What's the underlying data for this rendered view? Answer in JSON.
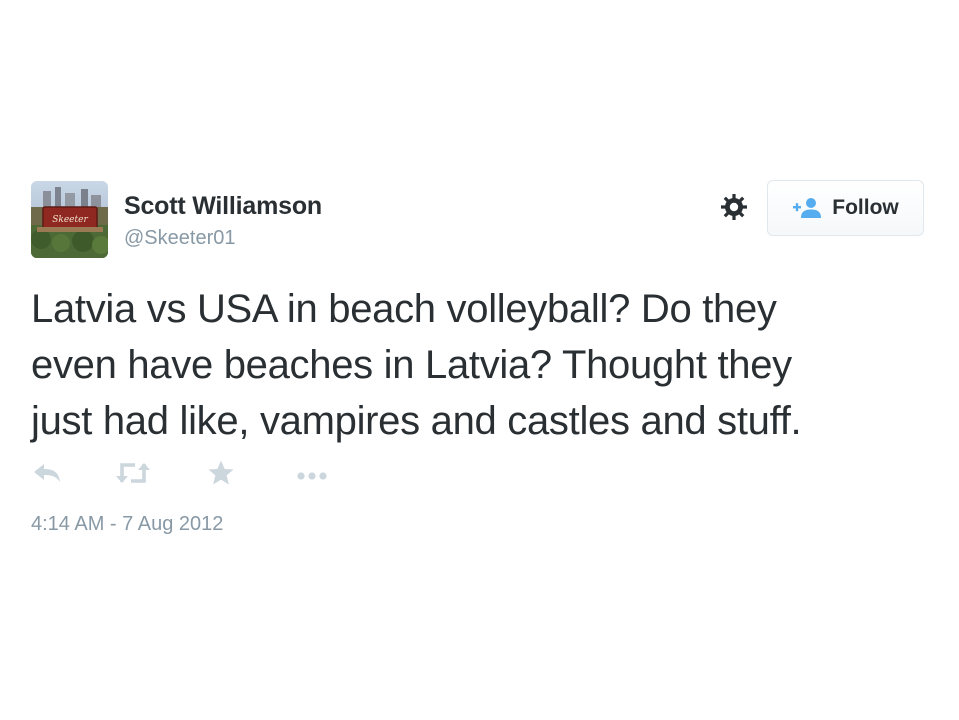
{
  "user": {
    "display_name": "Scott Williamson",
    "screen_name": "@Skeeter01",
    "avatar_sign_text": "Skeeter"
  },
  "header": {
    "settings_icon": "gear-icon",
    "follow_label": "Follow",
    "follow_icon": "follow-user-icon"
  },
  "tweet": {
    "lines": [
      "Latvia vs USA in beach volleyball? Do they",
      "even have beaches in Latvia? Thought they",
      "just had like, vampires and castles and stuff."
    ]
  },
  "actions": [
    {
      "name": "reply",
      "icon": "reply-icon"
    },
    {
      "name": "retweet",
      "icon": "retweet-icon"
    },
    {
      "name": "favorite",
      "icon": "star-icon"
    },
    {
      "name": "more",
      "icon": "more-icon"
    }
  ],
  "timestamp": "4:14 AM - 7 Aug 2012",
  "colors": {
    "text": "#292f33",
    "secondary": "#8899a6",
    "icon": "#ccd6dd",
    "follow_accent": "#55acee",
    "border": "#e1e8ed"
  }
}
